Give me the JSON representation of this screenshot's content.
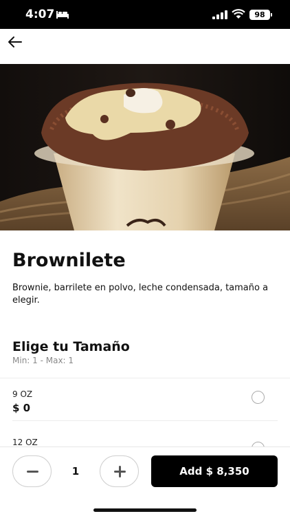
{
  "status_bar": {
    "time": "4:07",
    "battery": "98"
  },
  "product": {
    "name": "Brownilete",
    "description": "Brownie, barrilete en polvo, leche condensada, tamaño a elegir."
  },
  "size_section": {
    "title": "Elige tu Tamaño",
    "limits": "Min: 1 - Max: 1",
    "options": [
      {
        "name": "9 OZ",
        "price": "$ 0"
      },
      {
        "name": "12 OZ",
        "price": ""
      }
    ]
  },
  "cart": {
    "quantity": "1",
    "add_label": "Add $ 8,350"
  },
  "icons": [
    "bed-icon",
    "signal-icon",
    "wifi-icon",
    "back-arrow-icon",
    "minus-icon",
    "plus-icon"
  ]
}
